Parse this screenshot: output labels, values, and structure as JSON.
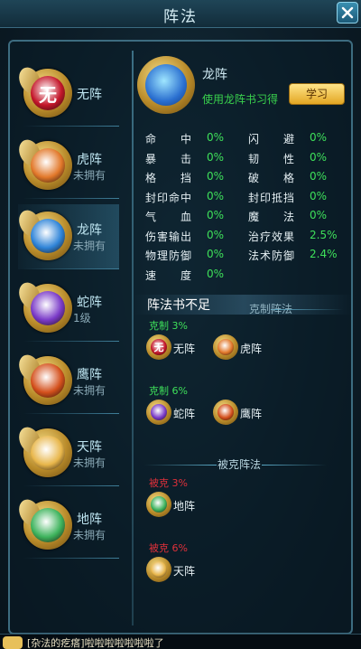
{
  "header": {
    "title": "阵法",
    "close_label": "✕"
  },
  "formations": [
    {
      "name": "无阵",
      "status": "",
      "emblem": "wu-emblem-icon",
      "glyph": "无",
      "color": "#c4162a"
    },
    {
      "name": "虎阵",
      "status": "未拥有",
      "emblem": "tiger-emblem-icon",
      "glyph": "",
      "color": "#e2782a"
    },
    {
      "name": "龙阵",
      "status": "未拥有",
      "emblem": "dragon-emblem-icon",
      "glyph": "",
      "color": "#2f84d8"
    },
    {
      "name": "蛇阵",
      "status": "1级",
      "emblem": "snake-emblem-icon",
      "glyph": "",
      "color": "#7a3ac8"
    },
    {
      "name": "鹰阵",
      "status": "未拥有",
      "emblem": "eagle-emblem-icon",
      "glyph": "",
      "color": "#d4501c"
    },
    {
      "name": "天阵",
      "status": "未拥有",
      "emblem": "heaven-emblem-icon",
      "glyph": "",
      "color": "#e8b64a"
    },
    {
      "name": "地阵",
      "status": "未拥有",
      "emblem": "earth-emblem-icon",
      "glyph": "",
      "color": "#3db35c"
    }
  ],
  "selected": {
    "name": "龙阵",
    "hint": "使用龙阵书习得",
    "learn_label": "学习",
    "stats_left": [
      {
        "label": "命　　中",
        "value": "0%"
      },
      {
        "label": "暴　　击",
        "value": "0%"
      },
      {
        "label": "格　　挡",
        "value": "0%"
      },
      {
        "label": "封印命中",
        "value": "0%"
      },
      {
        "label": "气　　血",
        "value": "0%"
      },
      {
        "label": "伤害输出",
        "value": "0%"
      },
      {
        "label": "物理防御",
        "value": "0%"
      },
      {
        "label": "速　　度",
        "value": "0%"
      }
    ],
    "stats_right": [
      {
        "label": "闪　　避",
        "value": "0%"
      },
      {
        "label": "韧　　性",
        "value": "0%"
      },
      {
        "label": "破　　格",
        "value": "0%"
      },
      {
        "label": "封印抵挡",
        "value": "0%"
      },
      {
        "label": "魔　　法",
        "value": "0%"
      },
      {
        "label": "治疗效果",
        "value": "2.5%"
      },
      {
        "label": "法术防御",
        "value": "2.4%"
      }
    ]
  },
  "tip": "阵法书不足",
  "counter": {
    "title": "克制阵法",
    "groups": [
      {
        "label": "克制 3%",
        "targets": [
          {
            "name": "无阵",
            "glyph": "无",
            "color": "#c4162a"
          },
          {
            "name": "虎阵",
            "glyph": "",
            "color": "#e2782a"
          }
        ]
      },
      {
        "label": "克制 6%",
        "targets": [
          {
            "name": "蛇阵",
            "glyph": "",
            "color": "#7a3ac8"
          },
          {
            "name": "鹰阵",
            "glyph": "",
            "color": "#d4501c"
          }
        ]
      }
    ]
  },
  "countered_by": {
    "title": "被克阵法",
    "groups": [
      {
        "label": "被克 3%",
        "targets": [
          {
            "name": "地阵",
            "glyph": "",
            "color": "#3db35c"
          }
        ]
      },
      {
        "label": "被克 6%",
        "targets": [
          {
            "name": "天阵",
            "glyph": "",
            "color": "#e8b64a"
          }
        ]
      }
    ]
  },
  "chat": {
    "message": "[杂法的疙瘩]啦啦啦啦啦啦啦了"
  },
  "colors": {
    "positive": "#3ee05a",
    "negative": "#e0303a",
    "accent_gold": "#e3a623"
  }
}
